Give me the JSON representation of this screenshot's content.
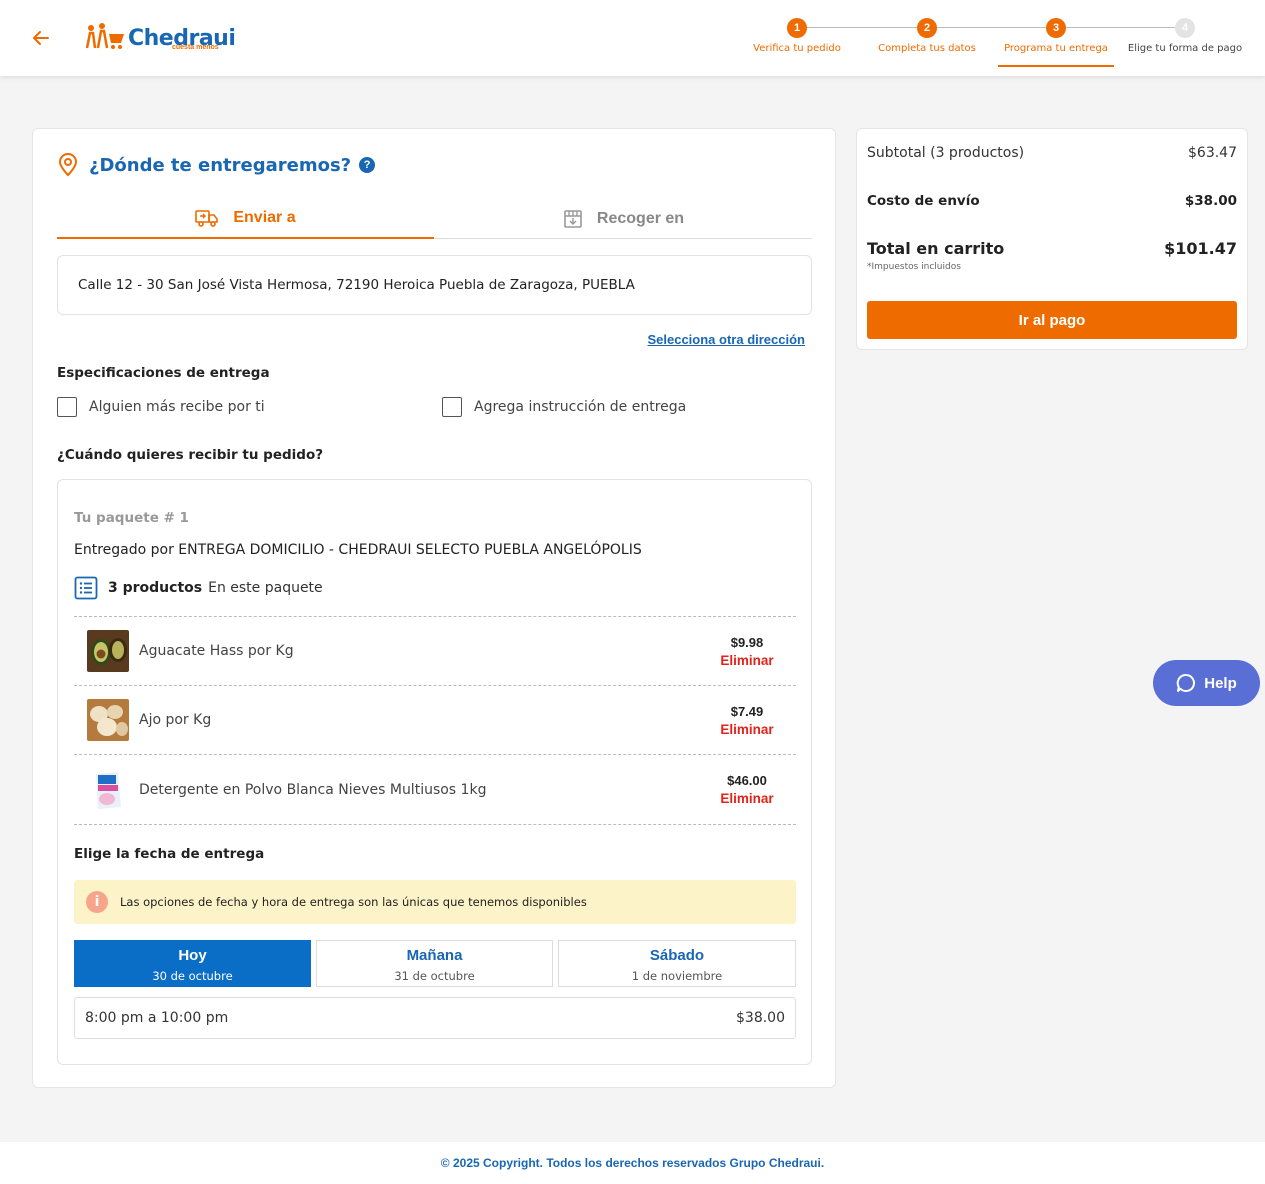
{
  "header": {
    "logo_text": "Chedraui",
    "logo_tagline": "cuesta menos",
    "steps": [
      {
        "number": "1",
        "label": "Verifica tu pedido",
        "state": "active"
      },
      {
        "number": "2",
        "label": "Completa tus datos",
        "state": "active"
      },
      {
        "number": "3",
        "label": "Programa tu entrega",
        "state": "active"
      },
      {
        "number": "4",
        "label": "Elige tu forma de pago",
        "state": "inactive"
      }
    ]
  },
  "delivery": {
    "title": "¿Dónde te entregaremos?",
    "help_mark": "?",
    "tabs": [
      {
        "label": "Enviar a",
        "icon": "truck-icon",
        "active": true
      },
      {
        "label": "Recoger en",
        "icon": "store-icon",
        "active": false
      }
    ],
    "address": "Calle 12 - 30 San José Vista Hermosa, 72190 Heroica Puebla de Zaragoza, PUEBLA",
    "other_address_link": "Selecciona otra dirección",
    "specs_label": "Especificaciones de entrega",
    "checkboxes": [
      "Alguien más recibe por ti",
      "Agrega instrucción de entrega"
    ],
    "when_label": "¿Cuándo quieres recibir tu pedido?"
  },
  "package": {
    "title": "Tu paquete # 1",
    "delivered_by": "Entregado por ENTREGA DOMICILIO - CHEDRAUI SELECTO PUEBLA ANGELÓPOLIS",
    "count_bold": "3 productos",
    "count_sub": "En este paquete",
    "items": [
      {
        "name": "Aguacate Hass por Kg",
        "price": "$9.98",
        "remove": "Eliminar",
        "thumb": "avocado-thumbnail"
      },
      {
        "name": "Ajo por Kg",
        "price": "$7.49",
        "remove": "Eliminar",
        "thumb": "garlic-thumbnail"
      },
      {
        "name": "Detergente en Polvo Blanca Nieves Multiusos 1kg",
        "price": "$46.00",
        "remove": "Eliminar",
        "thumb": "detergent-thumbnail"
      }
    ],
    "date_label": "Elige la fecha de entrega",
    "notice": "Las opciones de fecha y hora de entrega son las únicas que tenemos disponibles",
    "dates": [
      {
        "title": "Hoy",
        "sub": "30 de octubre",
        "selected": true
      },
      {
        "title": "Mañana",
        "sub": "31 de octubre",
        "selected": false
      },
      {
        "title": "Sábado",
        "sub": "1 de noviembre",
        "selected": false
      }
    ],
    "slot_time": "8:00 pm a 10:00 pm",
    "slot_price": "$38.00"
  },
  "summary": {
    "subtotal_label": "Subtotal (3 productos)",
    "subtotal_value": "$63.47",
    "shipping_label": "Costo de envío",
    "shipping_value": "$38.00",
    "total_label": "Total en carrito",
    "total_value": "$101.47",
    "tax_note": "*Impuestos incluidos",
    "pay_button": "Ir al pago"
  },
  "help_button": "Help",
  "footer": "© 2025 Copyright. Todos los derechos reservados Grupo Chedraui.",
  "colors": {
    "brand_orange": "#ee6b00",
    "brand_blue": "#1966b3",
    "selected_blue": "#0a6ec7",
    "remove_red": "#e2231a",
    "notice_yellow": "#fdf3c9",
    "help_purple": "#5a6fd6"
  }
}
